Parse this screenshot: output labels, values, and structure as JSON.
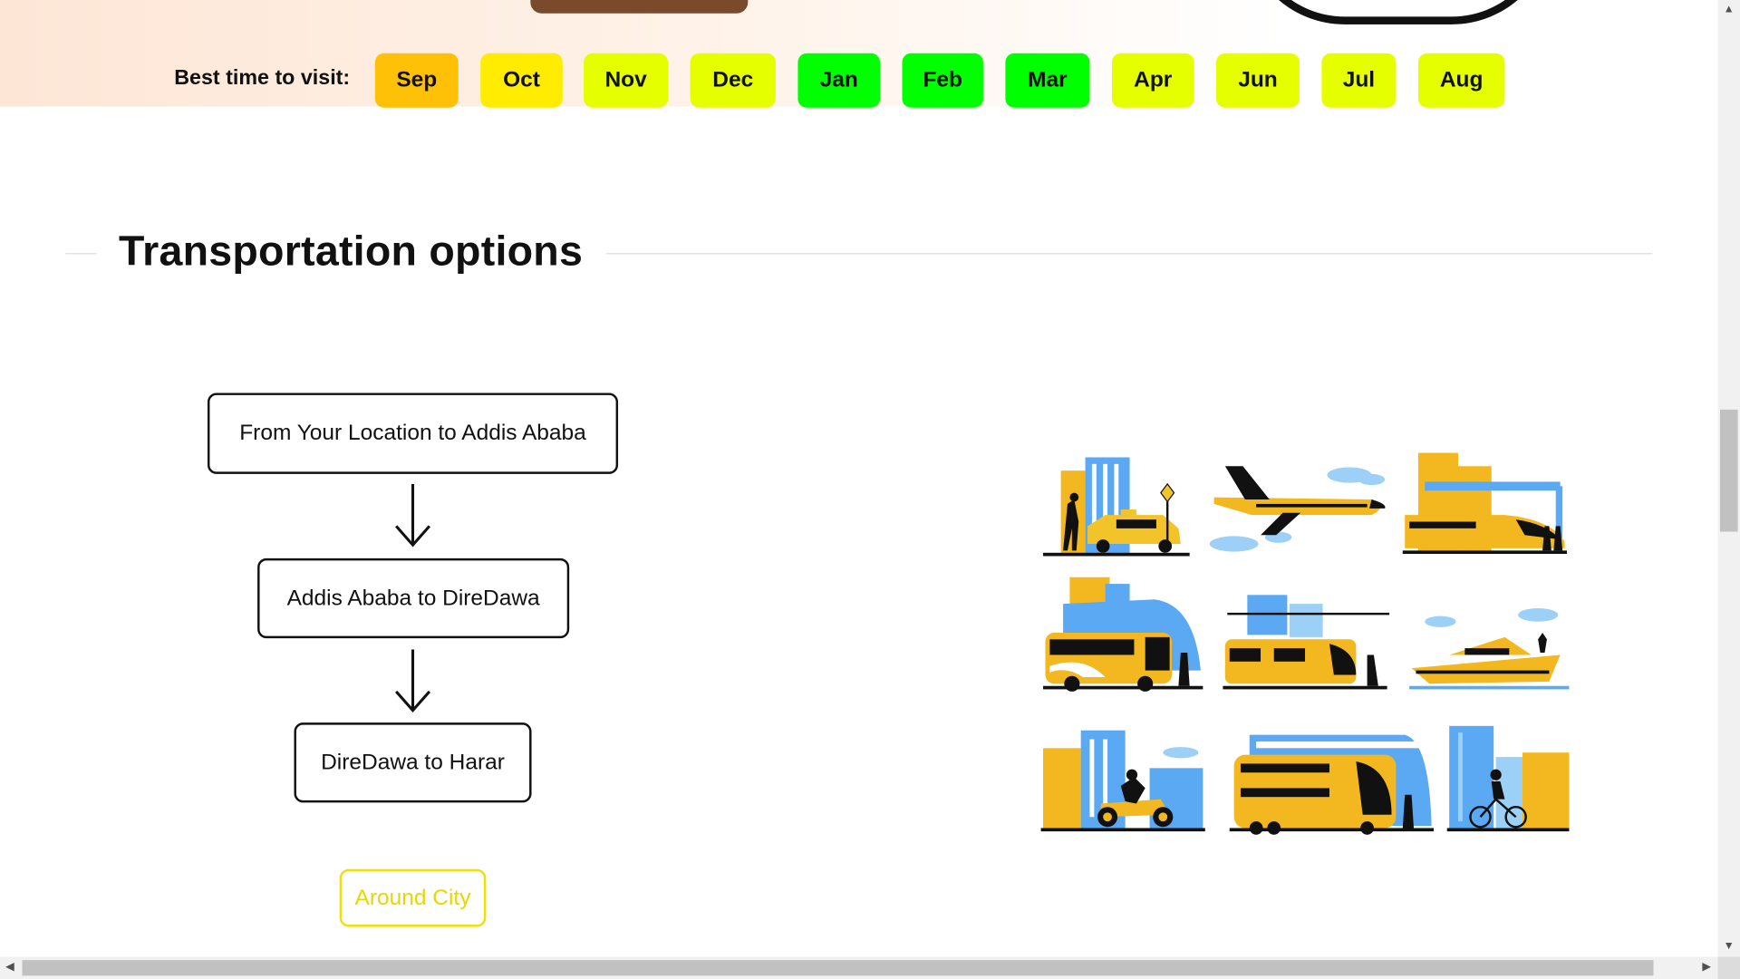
{
  "best_time": {
    "label": "Best time to visit:",
    "months": [
      {
        "name": "Sep",
        "color": "#ffc107"
      },
      {
        "name": "Oct",
        "color": "#ffec00"
      },
      {
        "name": "Nov",
        "color": "#e6ff00"
      },
      {
        "name": "Dec",
        "color": "#e6ff00"
      },
      {
        "name": "Jan",
        "color": "#00ff00"
      },
      {
        "name": "Feb",
        "color": "#00ff00"
      },
      {
        "name": "Mar",
        "color": "#00ff00"
      },
      {
        "name": "Apr",
        "color": "#e6ff00"
      },
      {
        "name": "Jun",
        "color": "#e6ff00"
      },
      {
        "name": "Jul",
        "color": "#e6ff00"
      },
      {
        "name": "Aug",
        "color": "#e6ff00"
      }
    ]
  },
  "transportation": {
    "title": "Transportation options",
    "route_steps": [
      "From Your Location to Addis Ababa",
      "Addis Ababa to DireDawa",
      "DireDawa to Harar"
    ],
    "around_city_button": "Around City",
    "illustration_icons": [
      "taxi-icon",
      "airplane-icon",
      "high-speed-train-icon",
      "bus-icon",
      "tram-icon",
      "yacht-icon",
      "motorcycle-icon",
      "double-decker-bus-icon",
      "bicycle-icon"
    ]
  },
  "colors": {
    "accent_yellow": "#f3c32a",
    "accent_blue": "#5aa9f2",
    "around_city_border": "#f3e000"
  }
}
